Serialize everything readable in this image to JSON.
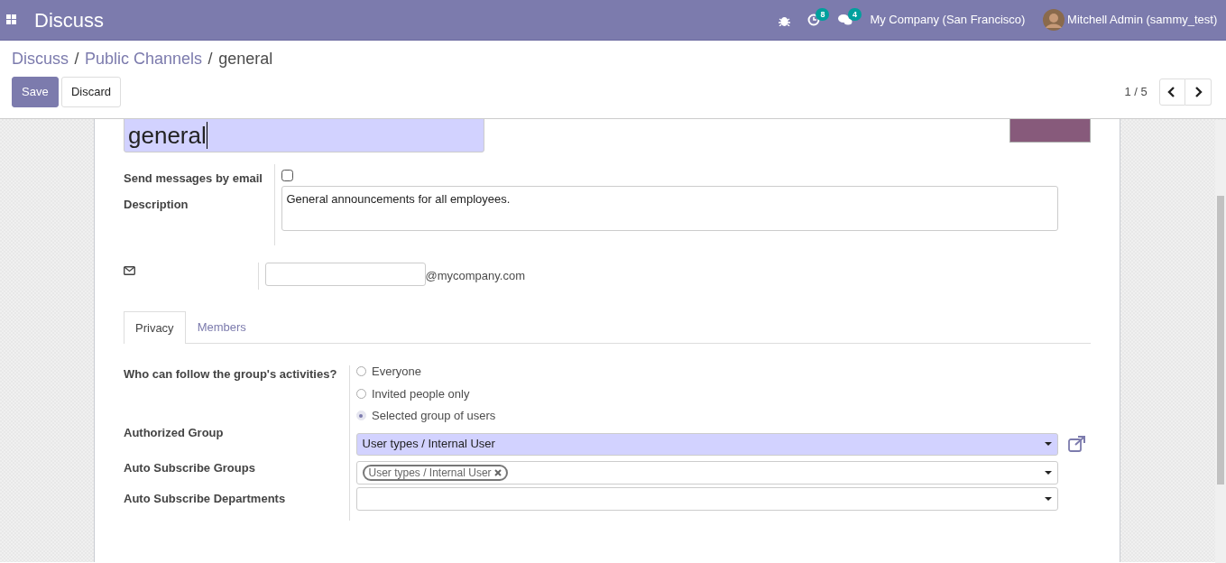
{
  "navbar": {
    "app_title": "Discuss",
    "activity_count": "8",
    "message_count": "4",
    "company": "My Company (San Francisco)",
    "user": "Mitchell Admin (sammy_test)"
  },
  "breadcrumbs": {
    "separator": "/",
    "items": [
      {
        "label": "Discuss"
      },
      {
        "label": "Public Channels"
      },
      {
        "label": "general"
      }
    ]
  },
  "buttons": [
    {
      "label": "Save",
      "kind": "primary"
    },
    {
      "label": "Discard",
      "kind": "secondary"
    }
  ],
  "pager": "1 / 5",
  "form": {
    "name": "general",
    "send_by_email": {
      "label": "Send messages by email",
      "checked": false
    },
    "description": {
      "label": "Description",
      "value": "General announcements for all employees."
    },
    "alias": {
      "domain": "@mycompany.com"
    },
    "tabs": [
      {
        "label": "Privacy",
        "selected": true
      },
      {
        "label": "Members",
        "selected": false
      }
    ],
    "privacy": {
      "follow_label": "Who can follow the group's activities?",
      "options": [
        {
          "label": "Everyone",
          "selected": false
        },
        {
          "label": "Invited people only",
          "selected": false
        },
        {
          "label": "Selected group of users",
          "selected": true
        }
      ],
      "authorized_group": {
        "label": "Authorized Group",
        "value": "User types / Internal User"
      },
      "auto_subscribe_groups": {
        "label": "Auto Subscribe Groups",
        "tags": [
          "User types / Internal User"
        ]
      },
      "auto_subscribe_departments": {
        "label": "Auto Subscribe Departments"
      }
    }
  }
}
